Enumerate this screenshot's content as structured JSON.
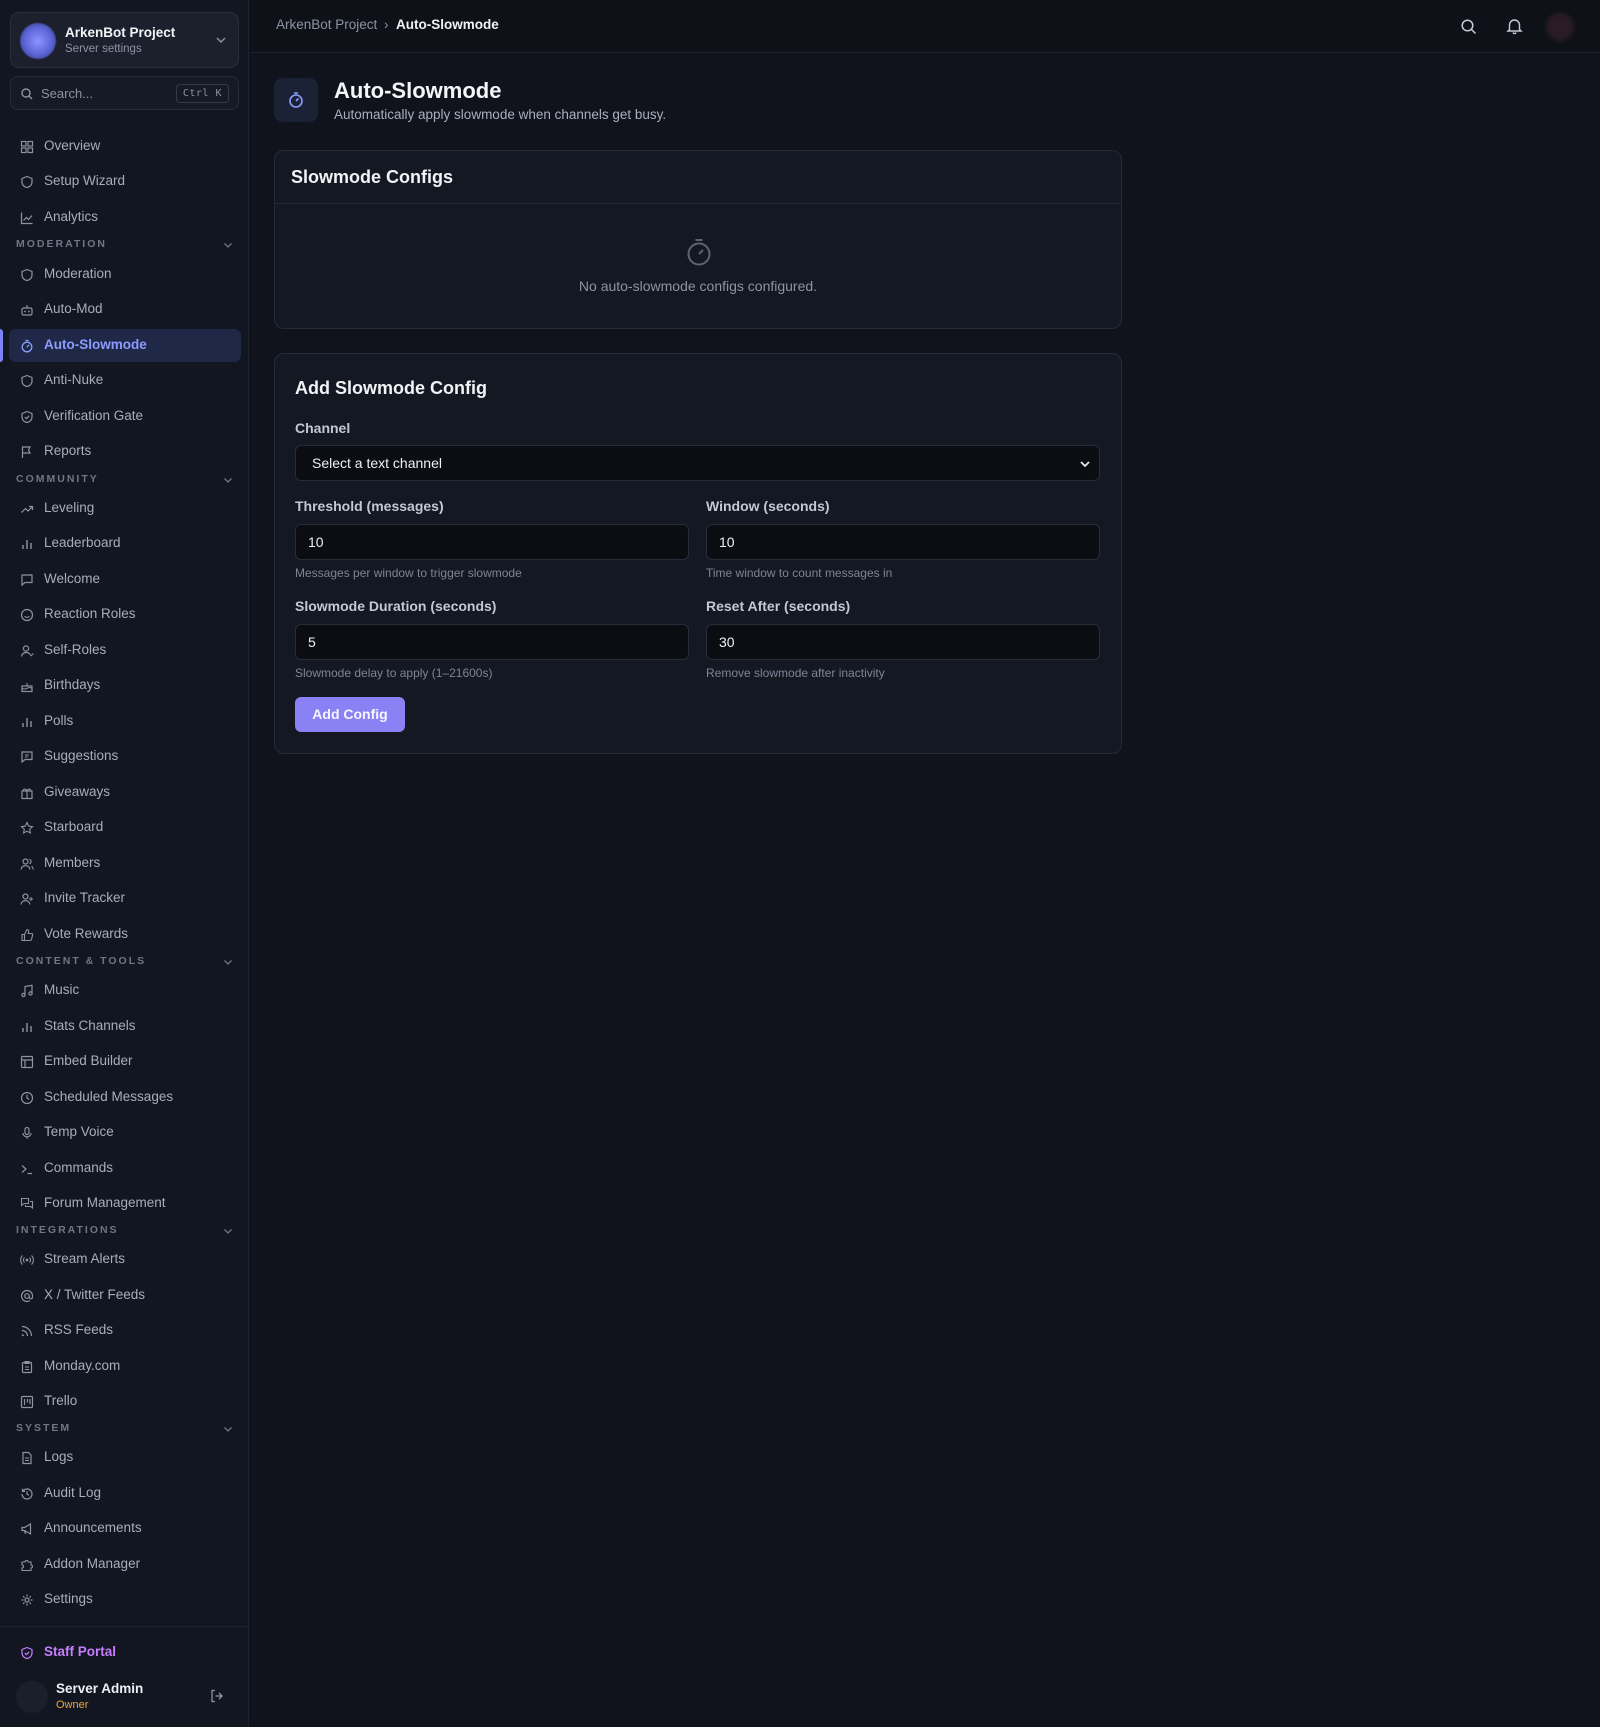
{
  "server": {
    "name": "ArkenBot Project",
    "subtitle": "Server settings"
  },
  "search": {
    "placeholder": "Search...",
    "shortcut": "Ctrl K"
  },
  "nav": {
    "top": [
      "Overview",
      "Setup Wizard",
      "Analytics"
    ],
    "moderation_title": "MODERATION",
    "moderation": [
      "Moderation",
      "Auto-Mod",
      "Auto-Slowmode",
      "Anti-Nuke",
      "Verification Gate",
      "Reports"
    ],
    "community_title": "COMMUNITY",
    "community": [
      "Leveling",
      "Leaderboard",
      "Welcome",
      "Reaction Roles",
      "Self-Roles",
      "Birthdays",
      "Polls",
      "Suggestions",
      "Giveaways",
      "Starboard",
      "Members",
      "Invite Tracker",
      "Vote Rewards"
    ],
    "content_title": "CONTENT & TOOLS",
    "content": [
      "Music",
      "Stats Channels",
      "Embed Builder",
      "Scheduled Messages",
      "Temp Voice",
      "Commands",
      "Forum Management"
    ],
    "integrations_title": "INTEGRATIONS",
    "integrations": [
      "Stream Alerts",
      "X / Twitter Feeds",
      "RSS Feeds",
      "Monday.com",
      "Trello"
    ],
    "system_title": "SYSTEM",
    "system": [
      "Logs",
      "Audit Log",
      "Announcements",
      "Addon Manager",
      "Settings"
    ],
    "staff_portal": "Staff Portal"
  },
  "user": {
    "name": "Server Admin",
    "role": "Owner"
  },
  "breadcrumb": {
    "root": "ArkenBot Project",
    "separator": "›",
    "current": "Auto-Slowmode"
  },
  "page": {
    "title": "Auto-Slowmode",
    "subtitle": "Automatically apply slowmode when channels get busy."
  },
  "configs": {
    "title": "Slowmode Configs",
    "empty_text": "No auto-slowmode configs configured."
  },
  "form": {
    "title": "Add Slowmode Config",
    "channel_label": "Channel",
    "channel_value": "Select a text channel",
    "threshold_label": "Threshold (messages)",
    "threshold_value": "10",
    "threshold_hint": "Messages per window to trigger slowmode",
    "window_label": "Window (seconds)",
    "window_value": "10",
    "window_hint": "Time window to count messages in",
    "duration_label": "Slowmode Duration (seconds)",
    "duration_value": "5",
    "duration_hint": "Slowmode delay to apply (1–21600s)",
    "reset_label": "Reset After (seconds)",
    "reset_value": "30",
    "reset_hint": "Remove slowmode after inactivity",
    "submit": "Add Config"
  },
  "colors": {
    "accent": "#8d9bff",
    "button": "#8a82f4",
    "staff": "#c77dff",
    "owner": "#f0a63c"
  }
}
